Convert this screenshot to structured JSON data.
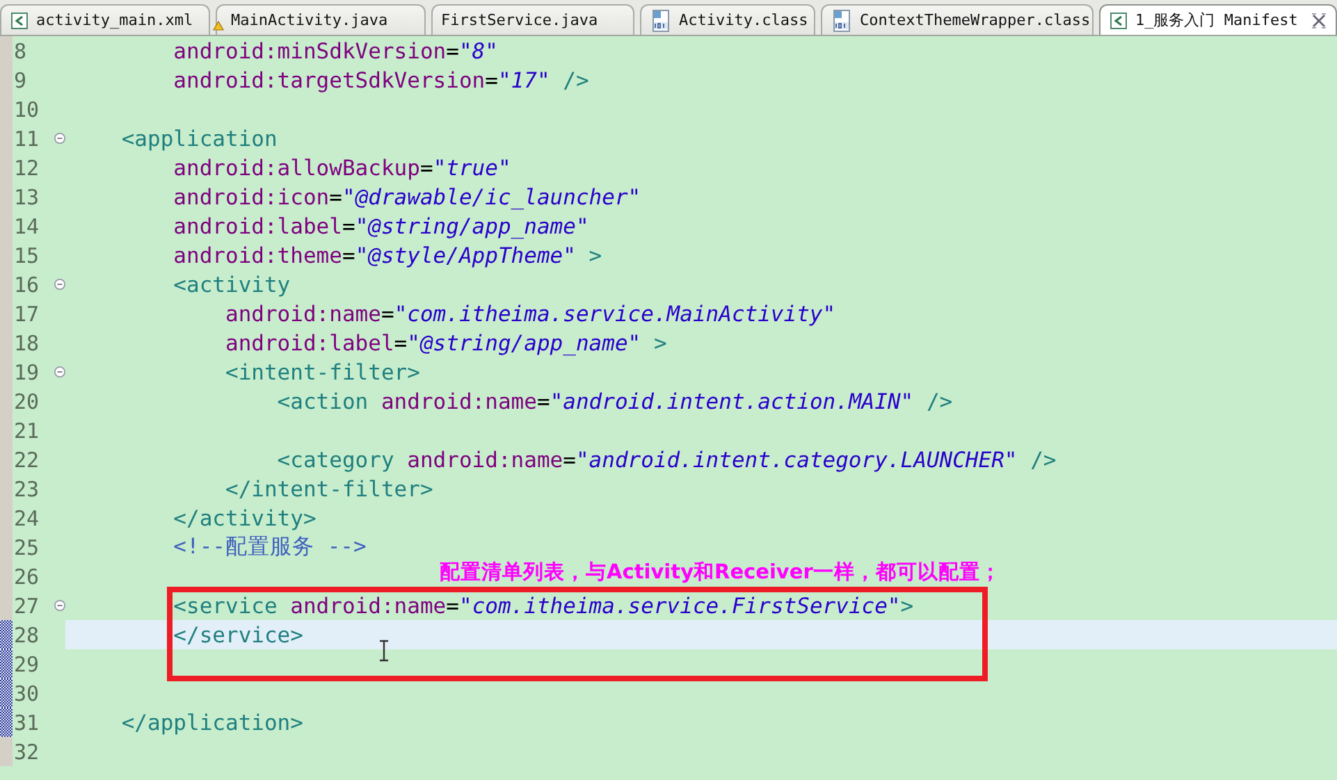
{
  "tabs": [
    {
      "label": "activity_main.xml",
      "kind": "xml",
      "warning": false,
      "selected": false
    },
    {
      "label": "MainActivity.java",
      "kind": "java",
      "warning": true,
      "selected": false
    },
    {
      "label": "FirstService.java",
      "kind": "java",
      "warning": false,
      "selected": false
    },
    {
      "label": "Activity.class",
      "kind": "class",
      "warning": false,
      "selected": false
    },
    {
      "label": "ContextThemeWrapper.class",
      "kind": "class",
      "warning": false,
      "selected": false
    },
    {
      "label": "1_服务入门 Manifest",
      "kind": "xml",
      "warning": false,
      "selected": true
    }
  ],
  "lines": [
    {
      "number": "8",
      "fold": false,
      "changed": false,
      "current": false,
      "tokens": [
        {
          "kind": "attr",
          "text": "        android:minSdkVersion"
        },
        {
          "kind": "plain",
          "text": "="
        },
        {
          "kind": "value",
          "text": "\"8\""
        }
      ]
    },
    {
      "number": "9",
      "fold": false,
      "changed": false,
      "current": false,
      "tokens": [
        {
          "kind": "attr",
          "text": "        android:targetSdkVersion"
        },
        {
          "kind": "plain",
          "text": "="
        },
        {
          "kind": "value",
          "text": "\"17\""
        },
        {
          "kind": "tag",
          "text": " />"
        }
      ]
    },
    {
      "number": "10",
      "fold": false,
      "changed": false,
      "current": false
    },
    {
      "number": "11",
      "fold": true,
      "changed": false,
      "current": false,
      "tokens": [
        {
          "kind": "tag",
          "text": "    <application"
        }
      ]
    },
    {
      "number": "12",
      "fold": false,
      "changed": false,
      "current": false,
      "tokens": [
        {
          "kind": "attr",
          "text": "        android:allowBackup"
        },
        {
          "kind": "plain",
          "text": "="
        },
        {
          "kind": "value",
          "text": "\"true\""
        }
      ]
    },
    {
      "number": "13",
      "fold": false,
      "changed": false,
      "current": false,
      "tokens": [
        {
          "kind": "attr",
          "text": "        android:icon"
        },
        {
          "kind": "plain",
          "text": "="
        },
        {
          "kind": "value",
          "text": "\"@drawable/ic_launcher\""
        }
      ]
    },
    {
      "number": "14",
      "fold": false,
      "changed": false,
      "current": false,
      "tokens": [
        {
          "kind": "attr",
          "text": "        android:label"
        },
        {
          "kind": "plain",
          "text": "="
        },
        {
          "kind": "value",
          "text": "\"@string/app_name\""
        }
      ]
    },
    {
      "number": "15",
      "fold": false,
      "changed": false,
      "current": false,
      "tokens": [
        {
          "kind": "attr",
          "text": "        android:theme"
        },
        {
          "kind": "plain",
          "text": "="
        },
        {
          "kind": "value",
          "text": "\"@style/AppTheme\""
        },
        {
          "kind": "tag",
          "text": " >"
        }
      ]
    },
    {
      "number": "16",
      "fold": true,
      "changed": false,
      "current": false,
      "tokens": [
        {
          "kind": "tag",
          "text": "        <activity"
        }
      ]
    },
    {
      "number": "17",
      "fold": false,
      "changed": false,
      "current": false,
      "tokens": [
        {
          "kind": "attr",
          "text": "            android:name"
        },
        {
          "kind": "plain",
          "text": "="
        },
        {
          "kind": "value",
          "text": "\"com.itheima.service.MainActivity\""
        }
      ]
    },
    {
      "number": "18",
      "fold": false,
      "changed": false,
      "current": false,
      "tokens": [
        {
          "kind": "attr",
          "text": "            android:label"
        },
        {
          "kind": "plain",
          "text": "="
        },
        {
          "kind": "value",
          "text": "\"@string/app_name\""
        },
        {
          "kind": "tag",
          "text": " >"
        }
      ]
    },
    {
      "number": "19",
      "fold": true,
      "changed": false,
      "current": false,
      "tokens": [
        {
          "kind": "tag",
          "text": "            <intent-filter>"
        }
      ]
    },
    {
      "number": "20",
      "fold": false,
      "changed": false,
      "current": false,
      "tokens": [
        {
          "kind": "tag",
          "text": "                <action"
        },
        {
          "kind": "attr",
          "text": " android:name"
        },
        {
          "kind": "plain",
          "text": "="
        },
        {
          "kind": "value",
          "text": "\"android.intent.action.MAIN\""
        },
        {
          "kind": "tag",
          "text": " />"
        }
      ]
    },
    {
      "number": "21",
      "fold": false,
      "changed": false,
      "current": false
    },
    {
      "number": "22",
      "fold": false,
      "changed": false,
      "current": false,
      "tokens": [
        {
          "kind": "tag",
          "text": "                <category"
        },
        {
          "kind": "attr",
          "text": " android:name"
        },
        {
          "kind": "plain",
          "text": "="
        },
        {
          "kind": "value",
          "text": "\"android.intent.category.LAUNCHER\""
        },
        {
          "kind": "tag",
          "text": " />"
        }
      ]
    },
    {
      "number": "23",
      "fold": false,
      "changed": false,
      "current": false,
      "tokens": [
        {
          "kind": "tag",
          "text": "            </intent-filter>"
        }
      ]
    },
    {
      "number": "24",
      "fold": false,
      "changed": false,
      "current": false,
      "tokens": [
        {
          "kind": "tag",
          "text": "        </activity>"
        }
      ]
    },
    {
      "number": "25",
      "fold": false,
      "changed": false,
      "current": false,
      "tokens": [
        {
          "kind": "comment",
          "text": "        <!--配置服务 -->"
        }
      ]
    },
    {
      "number": "26",
      "fold": false,
      "changed": false,
      "current": false
    },
    {
      "number": "27",
      "fold": true,
      "changed": false,
      "current": false,
      "tokens": [
        {
          "kind": "tag",
          "text": "        <service"
        },
        {
          "kind": "attr",
          "text": " android:name"
        },
        {
          "kind": "plain",
          "text": "="
        },
        {
          "kind": "value",
          "text": "\"com.itheima.service.FirstService\""
        },
        {
          "kind": "tag",
          "text": ">"
        }
      ]
    },
    {
      "number": "28",
      "fold": false,
      "changed": true,
      "current": true,
      "tokens": [
        {
          "kind": "tag",
          "text": "        </service>"
        }
      ]
    },
    {
      "number": "29",
      "fold": false,
      "changed": true,
      "current": false
    },
    {
      "number": "30",
      "fold": false,
      "changed": true,
      "current": false
    },
    {
      "number": "31",
      "fold": false,
      "changed": true,
      "current": false,
      "tokens": [
        {
          "kind": "tag",
          "text": "    </application>"
        }
      ]
    },
    {
      "number": "32",
      "fold": false,
      "changed": false,
      "current": false
    }
  ],
  "annotation": {
    "text": "配置清单列表，与Activity和Receiver一样，都可以配置；"
  }
}
